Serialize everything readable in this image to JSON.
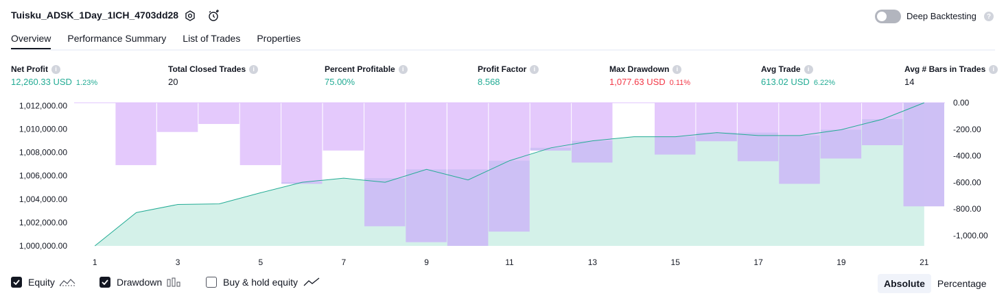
{
  "header": {
    "title": "Tuisku_ADSK_1Day_1ICH_4703dd28",
    "deep_backtesting_label": "Deep Backtesting",
    "deep_backtesting_on": false,
    "help_glyph": "?"
  },
  "tabs": [
    {
      "label": "Overview",
      "active": true
    },
    {
      "label": "Performance Summary",
      "active": false
    },
    {
      "label": "List of Trades",
      "active": false
    },
    {
      "label": "Properties",
      "active": false
    }
  ],
  "metrics": {
    "net_profit": {
      "label": "Net Profit",
      "value": "12,260.33 USD",
      "pct": "1.23%"
    },
    "total_closed_trades": {
      "label": "Total Closed Trades",
      "value": "20"
    },
    "percent_profitable": {
      "label": "Percent Profitable",
      "value": "75.00%"
    },
    "profit_factor": {
      "label": "Profit Factor",
      "value": "8.568"
    },
    "max_drawdown": {
      "label": "Max Drawdown",
      "value": "1,077.63 USD",
      "pct": "0.11%"
    },
    "avg_trade": {
      "label": "Avg Trade",
      "value": "613.02 USD",
      "pct": "6.22%"
    },
    "avg_bars": {
      "label": "Avg # Bars in Trades",
      "value": "14"
    },
    "info_glyph": "i"
  },
  "colors": {
    "positive": "#22ab94",
    "negative": "#f23645",
    "drawdown_bar": "#e1c3fc",
    "overlap_bar": "#c4bcf2",
    "equity_line": "#22ab94",
    "equity_fill": "#cdeee5"
  },
  "chart_data": {
    "type": "line",
    "x": [
      1,
      2,
      3,
      4,
      5,
      6,
      7,
      8,
      9,
      10,
      11,
      12,
      13,
      14,
      15,
      16,
      17,
      18,
      19,
      20,
      21
    ],
    "x_ticks": [
      "1",
      "3",
      "5",
      "7",
      "9",
      "11",
      "13",
      "15",
      "17",
      "19",
      "21"
    ],
    "series": [
      {
        "name": "Equity",
        "type": "area",
        "values": [
          1000000,
          1002850,
          1003550,
          1003600,
          1004550,
          1005450,
          1005800,
          1005450,
          1006550,
          1005650,
          1007300,
          1008400,
          1009000,
          1009350,
          1009350,
          1009700,
          1009450,
          1009450,
          1009950,
          1010850,
          1012260
        ]
      },
      {
        "name": "Drawdown",
        "type": "bar",
        "values": [
          0,
          -470,
          -220,
          -160,
          -470,
          -610,
          -360,
          -930,
          -1050,
          -1078,
          -970,
          -360,
          -450,
          0,
          -390,
          -290,
          -440,
          -610,
          -420,
          -320,
          -780
        ]
      }
    ],
    "left_axis": {
      "ticks": [
        "1,000,000.00",
        "1,002,000.00",
        "1,004,000.00",
        "1,006,000.00",
        "1,008,000.00",
        "1,010,000.00",
        "1,012,000.00"
      ],
      "ylim": [
        1000000,
        1012260
      ]
    },
    "right_axis": {
      "ticks": [
        "-1,000.00",
        "-800.00",
        "-600.00",
        "-400.00",
        "-200.00",
        "0.00"
      ],
      "ylim": [
        -1078,
        0
      ]
    }
  },
  "legend": {
    "equity": {
      "label": "Equity",
      "checked": true
    },
    "drawdown": {
      "label": "Drawdown",
      "checked": true
    },
    "buy_hold": {
      "label": "Buy & hold equity",
      "checked": false
    }
  },
  "view_mode": {
    "absolute": "Absolute",
    "percentage": "Percentage",
    "selected": "Absolute"
  }
}
